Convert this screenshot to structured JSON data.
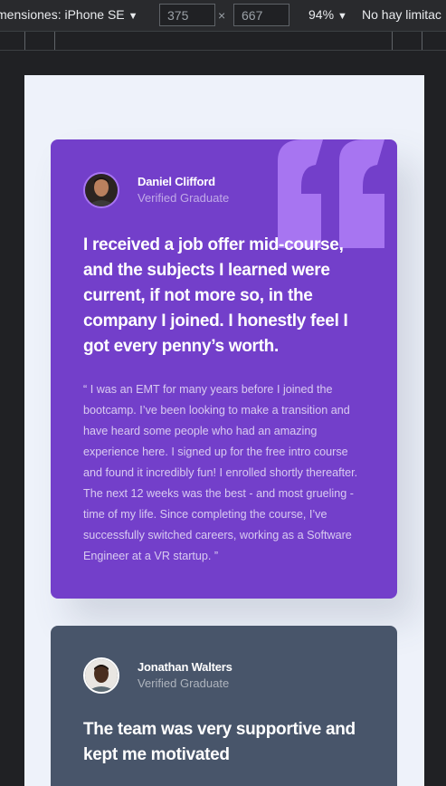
{
  "devtools": {
    "device_label": "mensiones: iPhone SE",
    "width_value": "375",
    "height_value": "667",
    "dimension_separator": "×",
    "zoom_label": "94%",
    "throttle_label": "No hay limitac"
  },
  "testimonials": [
    {
      "name": "Daniel Clifford",
      "role": "Verified Graduate",
      "headline": "I received a job offer mid-course, and the subjects I learned were current, if not more so, in the company I joined. I honestly feel I got every penny’s worth.",
      "body": "“ I was an EMT for many years before I joined the bootcamp. I’ve been looking to make a transition and have heard some people who had an amazing experience here. I signed up for the free intro course and found it incredibly fun! I enrolled shortly thereafter. The next 12 weeks was the best - and most grueling - time of my life. Since completing the course, I’ve successfully switched careers, working as a Software Engineer at a VR startup. ”",
      "background": "#733fca"
    },
    {
      "name": "Jonathan Walters",
      "role": "Verified Graduate",
      "headline": "The team was very supportive and kept me motivated",
      "background": "#48556a"
    }
  ],
  "colors": {
    "page_background": "#eef2fa",
    "accent_quote": "#a775f1"
  }
}
